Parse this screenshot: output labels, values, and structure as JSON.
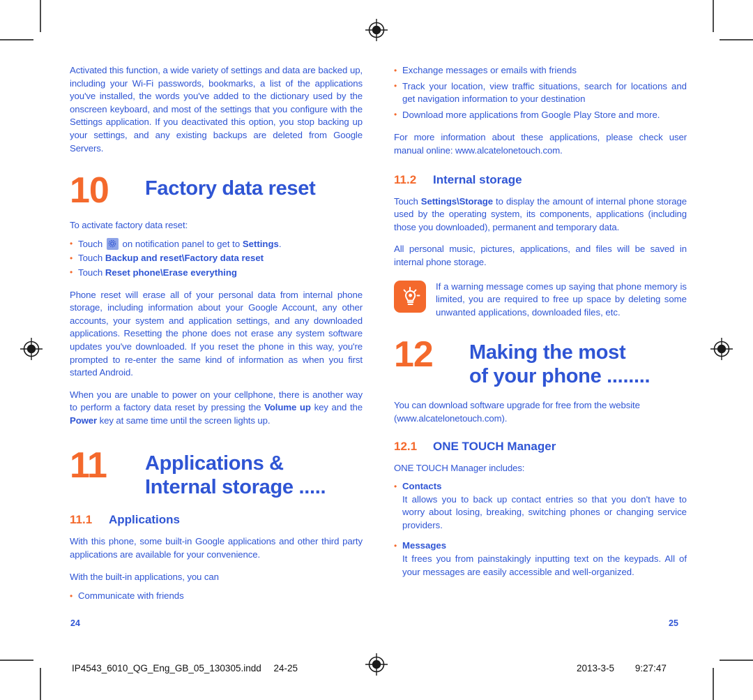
{
  "document": {
    "type": "print-spread",
    "colors": {
      "body_blue": "#2f55d4",
      "accent_orange": "#f4692c",
      "icon_chip_blue": "#8ea4e8",
      "crop_mark_gray": "#4a4a4a"
    }
  },
  "left_page": {
    "folio": "24",
    "intro_paragraph": "Activated this function, a wide variety of settings and data are backed up, including your Wi-Fi passwords, bookmarks, a list of the applications you've installed, the words you've added to the dictionary used by the onscreen keyboard, and most of the settings that you configure with the Settings application. If you deactivated this option, you stop backing up your settings, and any existing backups are deleted from Google Servers.",
    "chapter_10": {
      "number": "10",
      "title": "Factory data reset",
      "lead_in": "To activate factory data reset:",
      "steps": [
        {
          "prefix": "Touch ",
          "icon": "settings-gear-icon",
          "middle": " on notification panel to get to ",
          "bold": "Settings",
          "suffix": "."
        },
        {
          "prefix": "Touch ",
          "bold": "Backup and reset\\Factory data reset",
          "suffix": ""
        },
        {
          "prefix": "Touch ",
          "bold": "Reset phone\\Erase everything",
          "suffix": ""
        }
      ],
      "paragraph_1": "Phone reset will erase all of your personal data from internal phone storage, including information about your Google Account, any other accounts, your system and application settings, and any downloaded applications. Resetting the phone does not erase any system software updates you've downloaded. If you reset the phone in this way, you're prompted to re-enter the same kind of information as when you first started Android.",
      "paragraph_2_part1": "When you are unable to power on your cellphone, there is another way to perform a factory data reset by pressing the ",
      "paragraph_2_bold1": "Volume up",
      "paragraph_2_part2": " key and the ",
      "paragraph_2_bold2": "Power",
      "paragraph_2_part3": " key at same time until the screen lights up."
    },
    "chapter_11": {
      "number": "11",
      "title_line1": "Applications &",
      "title_line2": "Internal storage .....",
      "section_11_1": {
        "number": "11.1",
        "title": "Applications",
        "paragraph_1": "With this phone, some built-in Google applications and other third party applications are available for your convenience.",
        "paragraph_2": "With the built-in applications, you can",
        "bullets": [
          "Communicate with friends"
        ]
      }
    }
  },
  "right_page": {
    "folio": "25",
    "continued_bullets": [
      "Exchange messages or emails with friends",
      "Track your location, view traffic situations, search for locations and get navigation information to your destination",
      "Download more applications from Google Play Store and more."
    ],
    "more_info_paragraph": "For more information about these applications, please check user manual  online: www.alcatelonetouch.com.",
    "section_11_2": {
      "number": "11.2",
      "title": "Internal storage",
      "paragraph_1_part1": "Touch ",
      "paragraph_1_bold": "Settings\\Storage",
      "paragraph_1_part2": " to display the amount of internal phone storage used by the operating system, its components, applications (including those you downloaded), permanent and temporary data.",
      "paragraph_2": "All personal music, pictures, applications, and files will be saved in internal phone storage.",
      "tip": {
        "icon": "lightbulb-icon",
        "text": "If a warning message comes up saying that phone memory is limited, you are required to free up space by deleting some unwanted applications, downloaded files, etc."
      }
    },
    "chapter_12": {
      "number": "12",
      "title_line1": "Making the most",
      "title_line2": "of your phone ........",
      "paragraph_1": "You can download software upgrade for free from the website (www.alcatelonetouch.com).",
      "section_12_1": {
        "number": "12.1",
        "title": "ONE TOUCH Manager",
        "lead_in": "ONE TOUCH Manager includes:",
        "items": [
          {
            "label": "Contacts",
            "description": "It allows you to back up contact entries so that you don't have to worry about losing, breaking, switching phones or changing service providers."
          },
          {
            "label": "Messages",
            "description": "It frees you from painstakingly inputting text on the keypads. All of your messages are easily accessible and well-organized."
          }
        ]
      }
    }
  },
  "footer": {
    "slug_filename": "IP4543_6010_QG_Eng_GB_05_130305.indd",
    "slug_pages": "24-25",
    "date": "2013-3-5",
    "time": "9:27:47"
  }
}
